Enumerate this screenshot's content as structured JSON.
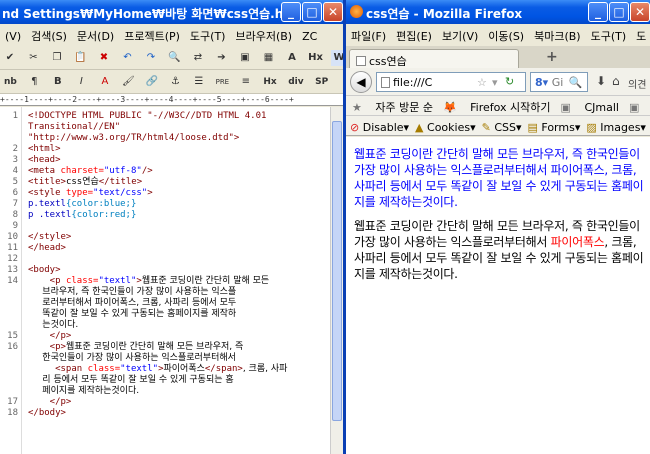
{
  "editor": {
    "title": "nd Settings₩MyHome₩바탕 화면₩css연습.html •...",
    "menu": [
      "(V)",
      "검색(S)",
      "문서(D)",
      "프로젝트(P)",
      "도구(T)",
      "브라우저(B)",
      "ZC"
    ],
    "toolbar2_text": [
      "nb",
      "¶",
      "H",
      "Hx",
      "div",
      "SP"
    ],
    "ruler": "+----1----+----2----+----3----+----4----+----5----+----6----+",
    "lines": [
      {
        "n": "1",
        "parts": [
          {
            "c": "tag",
            "t": "<!DOCTYPE HTML PUBLIC \"-//W3C//DTD HTML 4.01"
          }
        ]
      },
      {
        "n": "",
        "parts": [
          {
            "c": "tag",
            "t": "Transitional//EN\""
          }
        ]
      },
      {
        "n": "",
        "parts": [
          {
            "c": "tag",
            "t": "\"http://www.w3.org/TR/html4/loose.dtd\">"
          }
        ]
      },
      {
        "n": "2",
        "parts": [
          {
            "c": "tag",
            "t": "<html>"
          }
        ]
      },
      {
        "n": "3",
        "parts": [
          {
            "c": "tag",
            "t": "<head>"
          }
        ]
      },
      {
        "n": "4",
        "parts": [
          {
            "c": "tag",
            "t": "<meta "
          },
          {
            "c": "att",
            "t": "charset="
          },
          {
            "c": "val",
            "t": "\"utf-8\""
          },
          {
            "c": "tag",
            "t": "/>"
          }
        ]
      },
      {
        "n": "5",
        "parts": [
          {
            "c": "tag",
            "t": "<title>"
          },
          {
            "c": "",
            "t": "css연습"
          },
          {
            "c": "tag",
            "t": "</title>"
          }
        ]
      },
      {
        "n": "6",
        "parts": [
          {
            "c": "tag",
            "t": "<style "
          },
          {
            "c": "att",
            "t": "type="
          },
          {
            "c": "val",
            "t": "\"text/css\""
          },
          {
            "c": "tag",
            "t": ">"
          }
        ]
      },
      {
        "n": "7",
        "parts": [
          {
            "c": "sel",
            "t": "p.textl"
          },
          {
            "c": "cur",
            "t": "{color:blue;}"
          }
        ]
      },
      {
        "n": "8",
        "parts": [
          {
            "c": "sel",
            "t": "p .textl"
          },
          {
            "c": "cur",
            "t": "{color:red;}"
          }
        ]
      },
      {
        "n": "9",
        "parts": []
      },
      {
        "n": "10",
        "parts": [
          {
            "c": "tag",
            "t": "</style>"
          }
        ]
      },
      {
        "n": "11",
        "parts": [
          {
            "c": "tag",
            "t": "</head>"
          }
        ]
      },
      {
        "n": "12",
        "parts": []
      },
      {
        "n": "13",
        "parts": [
          {
            "c": "tag",
            "t": "<body>"
          }
        ]
      },
      {
        "n": "14",
        "parts": [
          {
            "c": "tag",
            "t": "    <p "
          },
          {
            "c": "att",
            "t": "class="
          },
          {
            "c": "val",
            "t": "\"textl\""
          },
          {
            "c": "tag",
            "t": ">"
          },
          {
            "c": "ko",
            "t": "웹표준 코딩이란 간단히 말해 모든"
          }
        ]
      },
      {
        "n": "",
        "parts": [
          {
            "c": "ko",
            "t": "     브라우저, 즉 한국인들이 가장 많이 사용하는 익스플"
          }
        ]
      },
      {
        "n": "",
        "parts": [
          {
            "c": "ko",
            "t": "     로러부터해서 파이어폭스, 크롬, 사파리 등에서 모두"
          }
        ]
      },
      {
        "n": "",
        "parts": [
          {
            "c": "ko",
            "t": "     똑같이 잘 보일 수 있게 구동되는 홈페이지를 제작하"
          }
        ]
      },
      {
        "n": "",
        "parts": [
          {
            "c": "ko",
            "t": "     는것이다."
          }
        ]
      },
      {
        "n": "15",
        "parts": [
          {
            "c": "tag",
            "t": "    </p>"
          }
        ]
      },
      {
        "n": "16",
        "parts": [
          {
            "c": "tag",
            "t": "    <p>"
          },
          {
            "c": "ko",
            "t": "웹표준 코딩이란 간단히 말해 모든 브라우저, 즉"
          }
        ]
      },
      {
        "n": "",
        "parts": [
          {
            "c": "ko",
            "t": "     한국인들이 가장 많이 사용하는 익스플로러부터해서"
          }
        ]
      },
      {
        "n": "",
        "parts": [
          {
            "c": "tag",
            "t": "     <span "
          },
          {
            "c": "att",
            "t": "class="
          },
          {
            "c": "val",
            "t": "\"textl\""
          },
          {
            "c": "tag",
            "t": ">"
          },
          {
            "c": "ko",
            "t": "파이어폭스"
          },
          {
            "c": "tag",
            "t": "</span>"
          },
          {
            "c": "ko",
            "t": ", 크롬, 사파"
          }
        ]
      },
      {
        "n": "",
        "parts": [
          {
            "c": "ko",
            "t": "     리 등에서 모두 똑같이 잘 보일 수 있게 구동되는 홈"
          }
        ]
      },
      {
        "n": "",
        "parts": [
          {
            "c": "ko",
            "t": "     페이지를 제작하는것이다."
          }
        ]
      },
      {
        "n": "17",
        "parts": [
          {
            "c": "tag",
            "t": "    </p>"
          }
        ]
      },
      {
        "n": "18",
        "parts": [
          {
            "c": "tag",
            "t": "</body>"
          }
        ]
      }
    ]
  },
  "firefox": {
    "title": "css연습 - Mozilla Firefox",
    "menu": [
      "파일(F)",
      "편집(E)",
      "보기(V)",
      "이동(S)",
      "북마크(B)",
      "도구(T)",
      "도"
    ],
    "tab_label": "css연습",
    "new_tab": "+",
    "url": "file:///C",
    "search_placeholder": "Gi",
    "bookmarks": [
      "자주 방문 순",
      "Firefox 시작하기",
      "CJmall",
      "ESM"
    ],
    "bookmark_overflow": "»",
    "home_extra": "의견 보내",
    "devbar": [
      "Disable▾",
      "Cookies▾",
      "CSS▾",
      "Forms▾",
      "Images▾",
      "In"
    ],
    "para1": "웹표준 코딩이란 간단히 말해 모든 브라우저, 즉 한국인들이 가장 많이 사용하는 익스플로러부터해서 파이어폭스, 크롬, 사파리 등에서 모두 똑같이 잘 보일 수 있게 구동되는 홈페이지를 제작하는것이다.",
    "para2_a": "웹표준 코딩이란 간단히 말해 모든 브라우저, 즉 한국인들이 가장 많이 사용하는 익스플로러부터해서 ",
    "para2_span": "파이어폭스",
    "para2_b": ", 크롬, 사파리 등에서 모두 똑같이 잘 보일 수 있게 구동되는 홈페이지를 제작하는것이다."
  },
  "colors": {
    "blue": "#0000ff",
    "red": "#ff0000",
    "titlebar": "#0054e3"
  }
}
